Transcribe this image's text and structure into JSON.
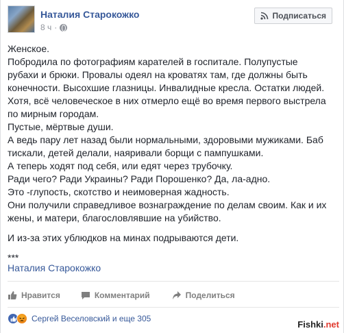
{
  "post": {
    "author": "Наталия Старокожко",
    "time": "8 ч",
    "subscribe_label": "Подписаться",
    "lines": [
      "Женское.",
      "Побродила по фотографиям карателей в госпитале. Полупустые",
      "рубахи и брюки. Провалы одеял на кроватях там, где должны быть",
      "конечности. Высохшие глазницы. Инвалидные кресла. Остатки людей.",
      "Хотя, всё человеческое в них отмерло ещё во время первого выстрела",
      "по мирным городам.",
      "Пустые, мёртвые души.",
      "А ведь пару лет назад были нормальными, здоровыми мужиками. Баб",
      "тискали, детей делали, наяривали борщи с пампушками.",
      "А теперь ходят под себя, или едят через трубочку.",
      "Ради чего? Ради Украины? Ради Порошенко? Да, ла-адно.",
      "Это -глупость, скотство и неимоверная жадность.",
      "Они получили справедливое вознаграждение по делам своим. Как и их",
      "жены, и матери, благословлявшие на убийство."
    ],
    "closing_line": "И из-за этих ублюдков на минах подрываются дети.",
    "stars": "***",
    "signature": "Наталия Старокожко"
  },
  "actions": {
    "like": "Нравится",
    "comment": "Комментарий",
    "share": "Поделиться"
  },
  "reactions": {
    "summary": "Сергей Веселовский и еще 305"
  },
  "watermark": {
    "text": "Fishki",
    "suffix": ".net"
  },
  "colors": {
    "link": "#365899",
    "text": "#1d2129",
    "muted": "#90949c",
    "like_blue": "#4267b2",
    "angry_orange": "#e9710f"
  }
}
